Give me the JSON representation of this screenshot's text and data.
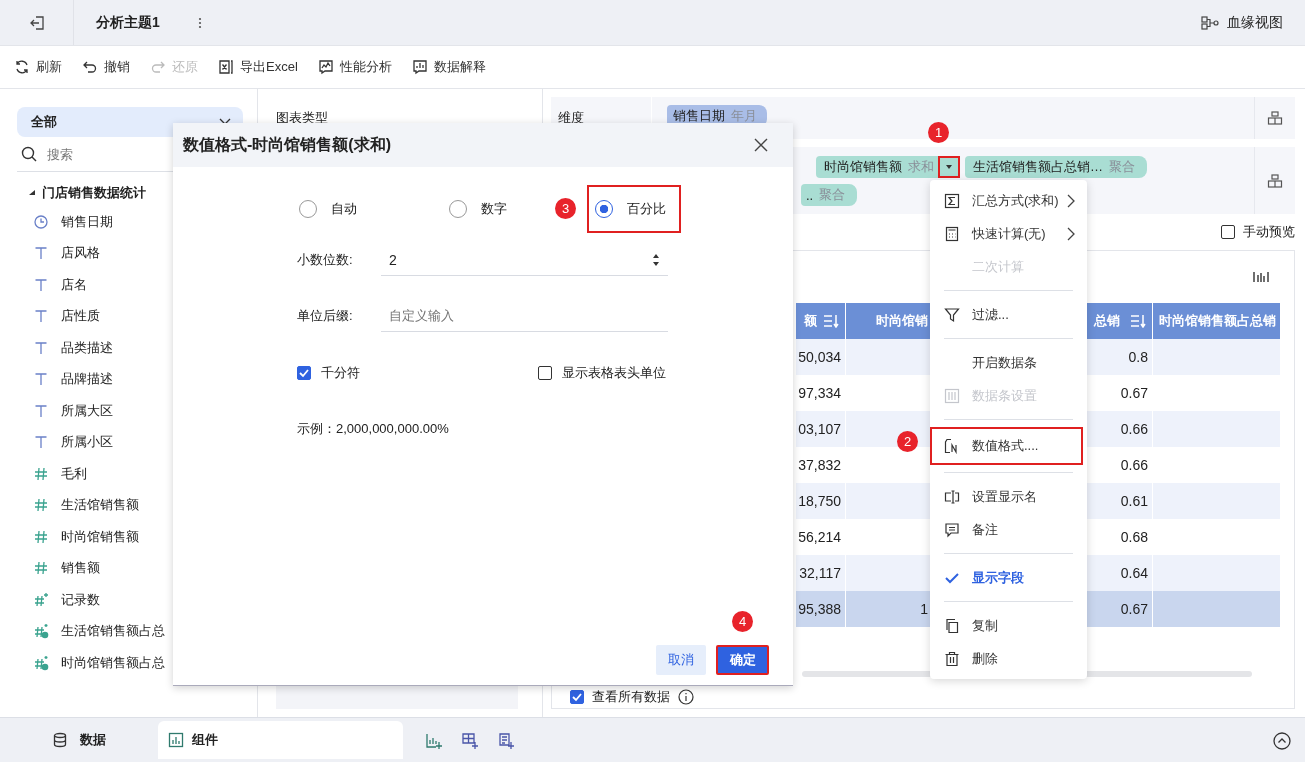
{
  "header": {
    "title": "分析主题1",
    "lineage": "血缘视图"
  },
  "toolbar": [
    {
      "label": "刷新",
      "disabled": false
    },
    {
      "label": "撤销",
      "disabled": false
    },
    {
      "label": "还原",
      "disabled": true
    },
    {
      "label": "导出Excel",
      "disabled": false
    },
    {
      "label": "性能分析",
      "disabled": false
    },
    {
      "label": "数据解释",
      "disabled": false
    }
  ],
  "sidebar": {
    "scope": "全部",
    "search_placeholder": "搜索",
    "group": {
      "label": "门店销售数据统计",
      "expanded": true,
      "children": [
        {
          "label": "销售日期",
          "kind": "date"
        },
        {
          "label": "店风格",
          "kind": "text"
        },
        {
          "label": "店名",
          "kind": "text"
        },
        {
          "label": "店性质",
          "kind": "text"
        },
        {
          "label": "品类描述",
          "kind": "text"
        },
        {
          "label": "品牌描述",
          "kind": "text"
        },
        {
          "label": "所属大区",
          "kind": "text"
        },
        {
          "label": "所属小区",
          "kind": "text"
        },
        {
          "label": "毛利",
          "kind": "number"
        },
        {
          "label": "生活馆销售额",
          "kind": "number"
        },
        {
          "label": "时尚馆销售额",
          "kind": "number"
        },
        {
          "label": "销售额",
          "kind": "number"
        },
        {
          "label": "记录数",
          "kind": "count"
        },
        {
          "label": "生活馆销售额占总",
          "kind": "formula"
        },
        {
          "label": "时尚馆销售额占总",
          "kind": "formula"
        }
      ]
    }
  },
  "center": {
    "chart_type_label": "图表类型"
  },
  "dimension": {
    "label": "维度",
    "chips": [
      {
        "name": "销售日期",
        "detail": "年月"
      }
    ]
  },
  "measures": {
    "chips": [
      {
        "name": "时尚馆销售额",
        "detail": "求和",
        "highlighted": true
      },
      {
        "name": "生活馆销售额占总销…",
        "detail": "聚合",
        "highlighted": false
      },
      {
        "name": "..",
        "detail": "聚合",
        "highlighted": false
      }
    ]
  },
  "manual_preview": {
    "label": "手动预览",
    "checked": false
  },
  "table": {
    "columns": [
      "额",
      "时尚馆销",
      "总销",
      "时尚馆销售额占总销"
    ],
    "rows": [
      {
        "cells": [
          "50,034",
          "",
          "0.8",
          ""
        ],
        "total": false
      },
      {
        "cells": [
          "97,334",
          "",
          "0.67",
          ""
        ],
        "total": false
      },
      {
        "cells": [
          "03,107",
          "",
          "0.66",
          ""
        ],
        "total": false
      },
      {
        "cells": [
          "37,832",
          "",
          "0.66",
          ""
        ],
        "total": false
      },
      {
        "cells": [
          "18,750",
          "",
          "0.61",
          ""
        ],
        "total": false
      },
      {
        "cells": [
          "56,214",
          "",
          "0.68",
          ""
        ],
        "total": false
      },
      {
        "cells": [
          "32,117",
          "",
          "0.64",
          ""
        ],
        "total": false
      },
      {
        "cells": [
          "95,388",
          "1",
          "0.67",
          ""
        ],
        "total": true
      }
    ]
  },
  "view_all": {
    "label": "查看所有数据",
    "checked": true
  },
  "bottom_tabs": [
    {
      "label": "数据",
      "selected": false
    },
    {
      "label": "组件",
      "selected": true
    }
  ],
  "dialog": {
    "title": "数值格式-时尚馆销售额(求和)",
    "formats": [
      {
        "label": "自动",
        "selected": false,
        "highlighted": false
      },
      {
        "label": "数字",
        "selected": false,
        "highlighted": false
      },
      {
        "label": "百分比",
        "selected": true,
        "highlighted": true
      }
    ],
    "decimals": {
      "label": "小数位数:",
      "value": "2"
    },
    "suffix": {
      "label": "单位后缀:",
      "placeholder": "自定义输入"
    },
    "options": [
      {
        "label": "千分符",
        "checked": true
      },
      {
        "label": "显示表格表头单位",
        "checked": false
      }
    ],
    "example": "示例：2,000,000,000.00%",
    "buttons": [
      {
        "label": "取消",
        "kind": "secondary",
        "highlighted": false
      },
      {
        "label": "确定",
        "kind": "primary",
        "highlighted": true
      }
    ]
  },
  "menu": {
    "sections": [
      [
        {
          "label": "汇总方式(求和)",
          "submenu": true,
          "disabled": false,
          "checked": false,
          "highlighted": false
        },
        {
          "label": "快速计算(无)",
          "submenu": true,
          "disabled": false,
          "checked": false,
          "highlighted": false
        },
        {
          "label": "二次计算",
          "submenu": false,
          "disabled": true,
          "checked": false,
          "highlighted": false
        }
      ],
      [
        {
          "label": "过滤...",
          "submenu": false,
          "disabled": false,
          "checked": false,
          "highlighted": false
        }
      ],
      [
        {
          "label": "开启数据条",
          "submenu": false,
          "disabled": false,
          "checked": false,
          "highlighted": false
        },
        {
          "label": "数据条设置",
          "submenu": false,
          "disabled": true,
          "checked": false,
          "highlighted": false
        }
      ],
      [
        {
          "label": "数值格式....",
          "submenu": false,
          "disabled": false,
          "checked": false,
          "highlighted": true
        }
      ],
      [
        {
          "label": "设置显示名",
          "submenu": false,
          "disabled": false,
          "checked": false,
          "highlighted": false
        },
        {
          "label": "备注",
          "submenu": false,
          "disabled": false,
          "checked": false,
          "highlighted": false
        }
      ],
      [
        {
          "label": "显示字段",
          "submenu": false,
          "disabled": false,
          "checked": true,
          "highlighted": false
        }
      ],
      [
        {
          "label": "复制",
          "submenu": false,
          "disabled": false,
          "checked": false,
          "highlighted": false
        },
        {
          "label": "删除",
          "submenu": false,
          "disabled": false,
          "checked": false,
          "highlighted": false
        }
      ]
    ]
  },
  "steps": [
    "1",
    "2",
    "3",
    "4"
  ]
}
